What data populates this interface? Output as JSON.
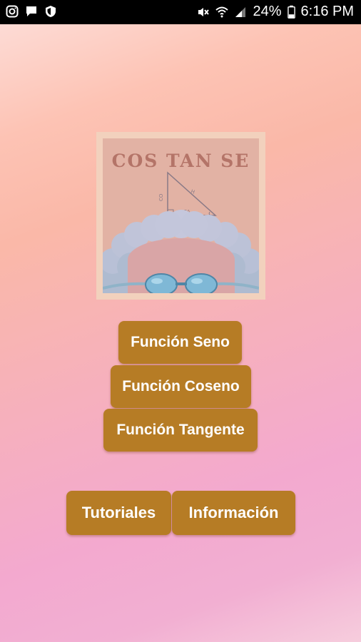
{
  "status_bar": {
    "battery_percent": "24%",
    "time": "6:16 PM",
    "icons_left": [
      "instagram-icon",
      "chat-icon",
      "shield-icon"
    ],
    "icons_right": [
      "mute-icon",
      "wifi-icon",
      "signal-icon",
      "battery-icon"
    ]
  },
  "logo": {
    "title": "COS TAN SE",
    "triangle_labels": {
      "hypotenuse": "H",
      "opposite": "CO",
      "adjacent": "CA"
    }
  },
  "menu": {
    "seno": "Función Seno",
    "coseno": "Función Coseno",
    "tangente": "Función Tangente"
  },
  "footer_buttons": {
    "tutoriales": "Tutoriales",
    "informacion": "Información"
  },
  "colors": {
    "button": "#b67c25",
    "button_text": "#ffffff",
    "logo_background": "#e2b2a4",
    "logo_frame": "#f2d1bd",
    "logo_title": "#b47468"
  }
}
